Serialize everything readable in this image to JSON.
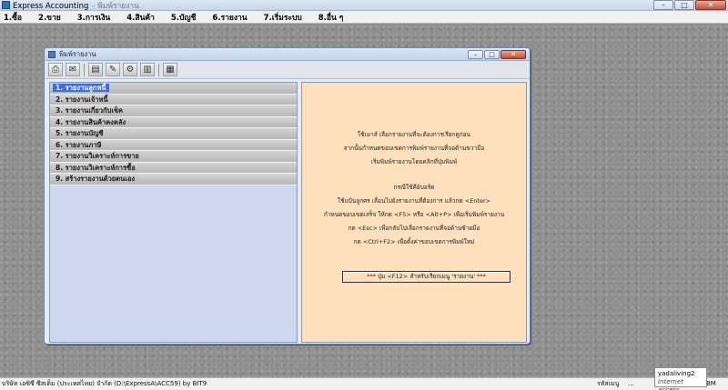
{
  "app": {
    "title": "Express Accounting",
    "title_suffix": "- พิมพ์รายงาน",
    "minimize": "–",
    "maximize": "□",
    "close": "✕"
  },
  "menubar": [
    "1.ซื้อ",
    "2.ขาย",
    "3.การเงิน",
    "4.สินค้า",
    "5.บัญชี",
    "6.รายงาน",
    "7.เริ่มระบบ",
    "8.อื่น ๆ"
  ],
  "dialog": {
    "title": "พิมพ์รายงาน",
    "minimize": "–",
    "maximize": "□",
    "close": "✕",
    "toolbar": [
      "print-icon",
      "email-icon",
      "document-icon",
      "edit-icon",
      "settings-icon",
      "grid-icon"
    ],
    "reports": [
      "1. รายงานลูกหนี้",
      "2. รายงานเจ้าหนี้",
      "3. รายงานเกี่ยวกับเช็ค",
      "4. รายงานสินค้าคงคลัง",
      "5. รายงานบัญชี",
      "6. รายงานภาษี",
      "7. รายงานวิเคราะห์การขาย",
      "8. รายงานวิเคราะห์การซื้อ",
      "9. สร้างรายงานด้วยตนเอง"
    ],
    "selected_index": 0,
    "instructions": {
      "line1": "ใช้เมาส์ เลือกรายงานที่จะต้องการเรียกดูก่อน",
      "line2": "จากนั้นกำหนดขอบเขตการพิมพ์รายงานที่จอด้านขวามือ",
      "line3": "เริ่มพิมพ์รายงานโดยคลิกที่ปุ่มพิมพ์",
      "keyboard_title": "กรณีใช้คีย์บอร์ด",
      "line4": "ใช้แป้นลูกศร เลื่อนไปยังรายงานที่ต้องการ  แล้วกด <Enter>",
      "line5": "กำหนดขอบเขตเสร็จ ให้กด <F5> หรือ <Alt+P>  เพื่อเริ่มพิมพ์รายงาน",
      "line6": "กด <Esc> เพื่อกลับไปเลือกรายงานที่จอด้านซ้ายมือ",
      "line7": "กด <Ctrl+F2> เพื่อตั้งค่าขอบเขตการพิมพ์ใหม่",
      "hint_box": "*** ปุ่ม <F12> สำหรับเรียกเมนู 'รายงาน' ***"
    }
  },
  "statusbar": {
    "company": "บริษัท เอซิซี ซีสเต็ม (ประเทศไทย) จำกัด (D:\\ExpressA\\ACC59) by BIT9",
    "menu_label": "รหัสเมนู",
    "dots": "...",
    "right": "BM SCRL"
  },
  "tooltip": {
    "name": "yadaliving2",
    "zone": "Internet access"
  }
}
